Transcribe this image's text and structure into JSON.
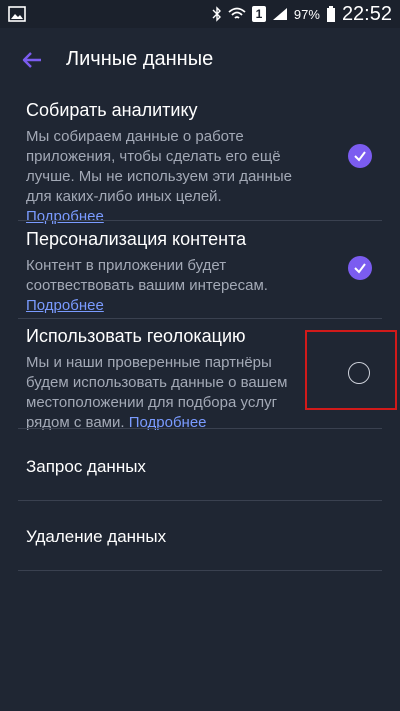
{
  "status_bar": {
    "battery_pct": "97%",
    "time": "22:52",
    "notif_badge": "1",
    "icons": [
      "gallery-icon",
      "bluetooth-icon",
      "wifi-icon",
      "signal-icon",
      "battery-icon"
    ]
  },
  "app_bar": {
    "title": "Личные данные",
    "back_icon": "arrow-left-icon"
  },
  "settings": [
    {
      "title": "Собирать аналитику",
      "description": "Мы собираем данные о работе приложения, чтобы сделать его ещё лучше. Мы не используем эти данные для каких-либо иных целей.",
      "link": "Подробнее",
      "enabled": true
    },
    {
      "title": "Персонализация контента",
      "description": "Контент в приложении будет соотвествовать вашим интересам.",
      "link": "Подробнее",
      "enabled": true
    },
    {
      "title": "Использовать геолокацию",
      "description": "Мы и наши проверенные партнёры будем использовать данные о вашем местоположении для подбора услуг рядом с вами.",
      "link": "Подробнее",
      "enabled": false
    }
  ],
  "actions": {
    "request_data": "Запрос данных",
    "delete_data": "Удаление данных"
  },
  "colors": {
    "background": "#1f2633",
    "accent": "#7b5cf0",
    "link": "#7a9bff",
    "highlight": "#d11a1a"
  }
}
